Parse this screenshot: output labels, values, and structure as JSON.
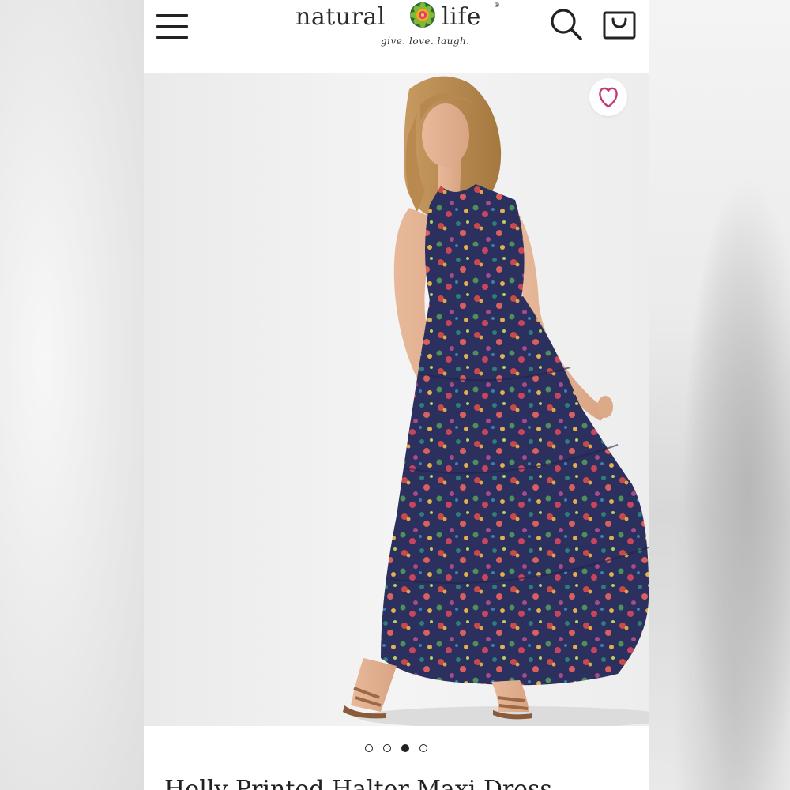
{
  "header": {
    "logo": {
      "word_left": "natural",
      "word_right": "life",
      "trademark": "®",
      "tagline": "give. love. laugh.",
      "flower_icon": "flower-logo-icon"
    },
    "menu_icon": "hamburger-menu-icon",
    "search_icon": "search-icon",
    "cart_icon": "shopping-bag-icon"
  },
  "gallery": {
    "image_alt": "Woman wearing a navy floral tiered halter maxi dress",
    "wishlist_icon": "heart-icon",
    "slide_count": 4,
    "active_slide": 3
  },
  "product": {
    "title": "Holly Printed Halter Maxi Dress"
  },
  "colors": {
    "heart": "#c2397b",
    "text": "#222222",
    "dress_base": "#2a2f5c"
  }
}
